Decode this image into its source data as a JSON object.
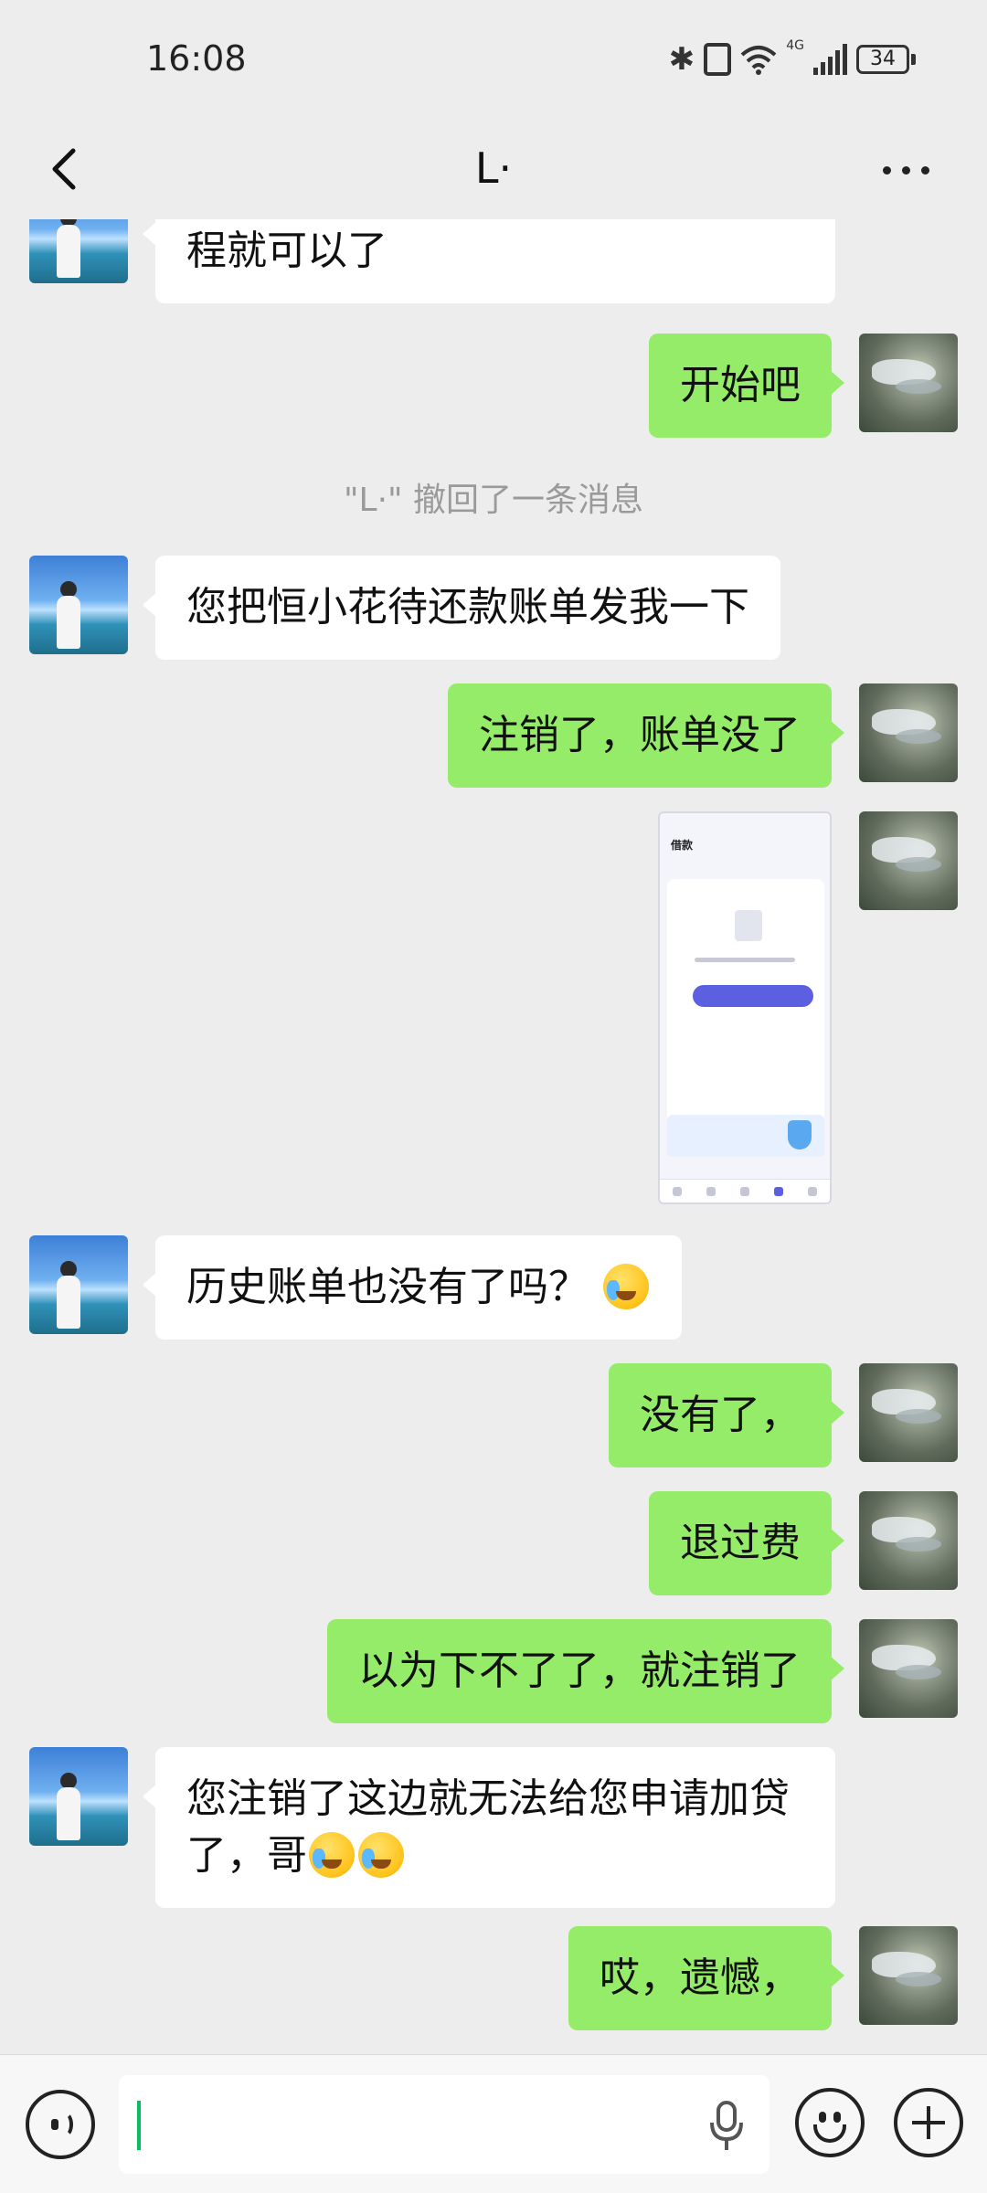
{
  "status_bar": {
    "time": "16:08",
    "network": "4G",
    "battery": "34",
    "icons": [
      "bluetooth-icon",
      "vibrate-icon",
      "wifi-icon",
      "signal-icon",
      "battery-icon"
    ]
  },
  "header": {
    "title": "L·",
    "back_icon": "chevron-left-icon",
    "more_icon": "more-dots-icon"
  },
  "messages": [
    {
      "sender": "other",
      "text": "程就可以了",
      "partial": true
    },
    {
      "sender": "me",
      "text": "开始吧"
    },
    {
      "sender": "system",
      "text": "\"L·\" 撤回了一条消息"
    },
    {
      "sender": "other",
      "text": "您把恒小花待还款账单发我一下"
    },
    {
      "sender": "me",
      "text": "注销了，账单没了"
    },
    {
      "sender": "me",
      "type": "image",
      "text": "借款"
    },
    {
      "sender": "other",
      "text": "历史账单也没有了吗？"
    },
    {
      "sender": "me",
      "text": "没有了，"
    },
    {
      "sender": "me",
      "text": "退过费"
    },
    {
      "sender": "me",
      "text": "以为下不了了，就注销了"
    },
    {
      "sender": "other",
      "text_line1": "您注销了这边就无法给您申请加贷",
      "text_line2": "了，哥"
    },
    {
      "sender": "me",
      "text": "哎，遗憾，"
    }
  ],
  "input_bar": {
    "placeholder": "",
    "voice_icon": "voice-icon",
    "mic_icon": "microphone-icon",
    "emoji_icon": "emoji-icon",
    "plus_icon": "plus-icon"
  },
  "colors": {
    "background": "#ededed",
    "bubble_me": "#95ec69",
    "bubble_other": "#ffffff",
    "caret": "#07c160"
  }
}
